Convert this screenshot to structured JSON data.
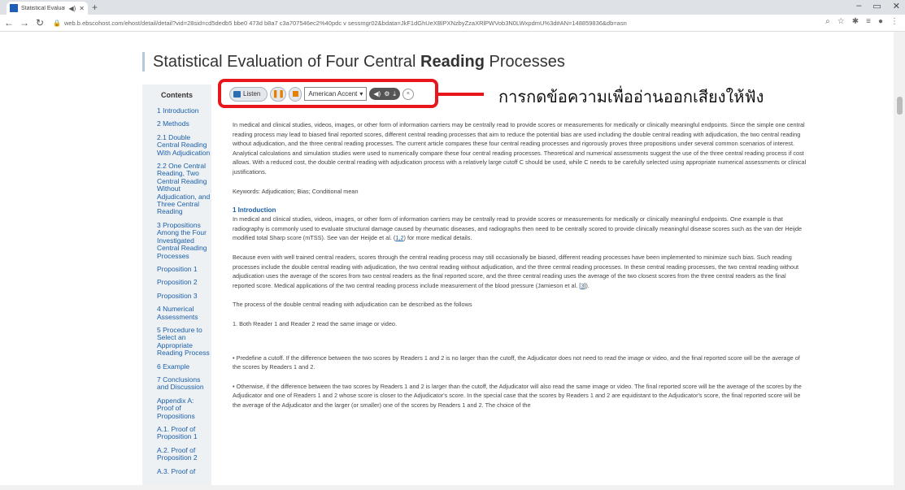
{
  "browser": {
    "tab_title": "Statistical Evaluation of Four",
    "tab_audio_icon": "speaker-icon",
    "url": "web.b.ebscohost.com/ehost/detail/detail?vid=28sid=cd5dedb5 bbe0 473d b8a7 c3a707546ec2%40pdc v sessmgr02&bdata=JkF1dGhUeXBlPXNzbyZzaXRlPWVob3N0LWxpdmU%3d#AN=148859836&db=asn",
    "window_controls": [
      "–",
      "▭",
      "✕"
    ]
  },
  "page": {
    "title_prefix": "Statistical Evaluation of Four Central ",
    "title_bold": "Reading",
    "title_suffix": " Processes"
  },
  "sidebar": {
    "heading": "Contents",
    "items": [
      "1 Introduction",
      "2 Methods",
      "2.1 Double Central Reading With Adjudication",
      "2.2 One Central Reading, Two Central Reading Without Adjudication, and Three Central Reading",
      "3 Propositions Among the Four Investigated Central Reading Processes",
      "Proposition 1",
      "Proposition 2",
      "Proposition 3",
      "4 Numerical Assessments",
      "5 Procedure to Select an Appropriate Reading Process",
      "6 Example",
      "7 Conclusions and Discussion",
      "Appendix A: Proof of Propositions",
      "A.1. Proof of Proposition 1",
      "A.2. Proof of Proposition 2",
      "A.3. Proof of"
    ]
  },
  "listen_toolbar": {
    "listen_label": "Listen",
    "pause_label": "❚❚",
    "accent_selected": "American Accent",
    "controls": [
      "volume-icon",
      "settings-icon",
      "download-icon"
    ],
    "close_label": "×"
  },
  "annotation": {
    "text": "การกดข้อความเพื่ออ่านออกเสียงให้ฟัง",
    "color": "#e8151a"
  },
  "article": {
    "abstract": "In medical and clinical studies, videos, images, or other form of information carriers may be centrally read to provide scores or measurements for medically or clinically meaningful endpoints. Since the simple one central reading process may lead to biased final reported scores, different central reading processes that aim to reduce the potential bias are used including the double central reading with adjudication, the two central reading without adjudication, and the three central reading processes. The current article compares these four central reading processes and rigorously proves three propositions under several common scenarios of interest. Analytical calculations and simulation studies were used to numerically compare these four central reading processes. Theoretical and numerical assessments suggest the use of the three central reading process if cost allows. With a reduced cost, the double central reading with adjudication process with a relatively large cutoff C should be used, while C needs to be carefully selected using appropriate numerical assessments or clinical justifications.",
    "keywords": "Keywords: Adjudication; Bias; Conditional mean",
    "intro_heading": "1 Introduction",
    "intro_p1": "In medical and clinical studies, videos, images, or other form of information carriers may be centrally read to provide scores or measurements for medically or clinically meaningful endpoints. One example is that radiography is commonly used to evaluate structural damage caused by rheumatic diseases, and radiographs then need to be centrally scored to provide clinically meaningful disease scores such as the van der Heijde modified total Sharp score (mTSS). See van der Heijde et al. (",
    "intro_p1_link": "1,2",
    "intro_p1_end": ") for more medical details.",
    "intro_p2": "Because even with well trained central readers, scores through the central reading process may still occasionally be biased, different reading processes have been implemented to minimize such bias. Such reading processes include the double central reading with adjudication, the two central reading without adjudication, and the three central reading processes. In these central reading processes, the two central reading without adjudication uses the average of the scores from two central readers as the final reported score, and the three central reading uses the average of the two closest scores from the three central readers as the final reported score. Medical applications of the two central reading process include measurement of the blood pressure (Jamieson et al. [",
    "intro_p2_link": "3",
    "intro_p2_end": "]).",
    "process_intro": "The process of the double central reading with adjudication can be described as the follows",
    "step1": "1. Both Reader 1 and Reader 2 read the same image or video.",
    "bullet1": "•  Predefine a cutoff. If the difference between the two scores by Readers 1 and 2 is no larger than the cutoff, the Adjudicator does not need to read the image or video, and the final reported score will be the average of the scores by Readers 1 and 2.",
    "bullet2": "•  Otherwise, if the difference between the two scores by Readers 1 and 2 is larger than the cutoff, the Adjudicator will also read the same image or video. The final reported score will be the average of the scores by the Adjudicator and one of Readers 1 and 2 whose score is closer to the Adjudicator's score. In the special case that the scores by Readers 1 and 2 are equidistant to the Adjudicator's score, the final reported score will be the average of the Adjudicator and the larger (or smaller) one of the scores by Readers 1 and 2. The choice of the"
  }
}
